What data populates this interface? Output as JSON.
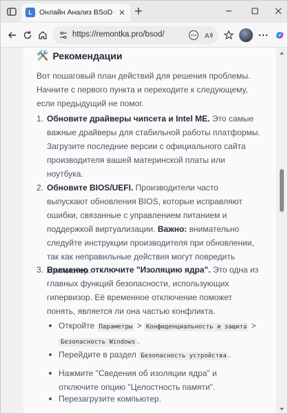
{
  "browser": {
    "tab_title": "Онлайн Анализ BSoD от remontka",
    "favicon_letter": "L",
    "url": "https://remontka.pro/bsod/"
  },
  "article": {
    "section_icon": "🛠️",
    "section_title": "Рекомендации",
    "intro": "Вот пошаговый план действий для решения проблемы. Начните с первого пункта и переходите к следующему, если предыдущий не помог.",
    "steps": [
      {
        "num": "1.",
        "bold": "Обновите драйверы чипсета и Intel ME.",
        "text": " Это самые важные драйверы для стабильной работы платформы. Загрузите последние версии с официального сайта производителя вашей материнской платы или ноутбука."
      },
      {
        "num": "2.",
        "bold": "Обновите BIOS/UEFI.",
        "text": " Производители часто выпускают обновления BIOS, которые исправляют ошибки, связанные с управлением питанием и поддержкой виртуализации. ",
        "bold2": "Важно:",
        "text2": " внимательно следуйте инструкции производителя при обновлении, так как неправильные действия могут повредить компьютер."
      },
      {
        "num": "3.",
        "bold": "Временно отключите \"Изоляцию ядра\".",
        "text": " Это одна из главных функций безопасности, использующих гипервизор. Её временное отключение поможет понять, является ли она частью конфликта."
      }
    ],
    "bullets": {
      "b1_prefix": "Откройте",
      "b1_code1": "Параметры",
      "b1_sep1": ">",
      "b1_code2": "Конфиденциальность и защита",
      "b1_sep2": ">",
      "b1_code3": "Безопасность Windows",
      "b1_end": ".",
      "b2_prefix": "Перейдите в раздел",
      "b2_code": "Безопасность устройства",
      "b2_end": ".",
      "b3": "Нажмите \"Сведения об изоляции ядра\" и отключите опцию \"Целостность памяти\".",
      "b4": "Перезагрузите компьютер."
    }
  }
}
